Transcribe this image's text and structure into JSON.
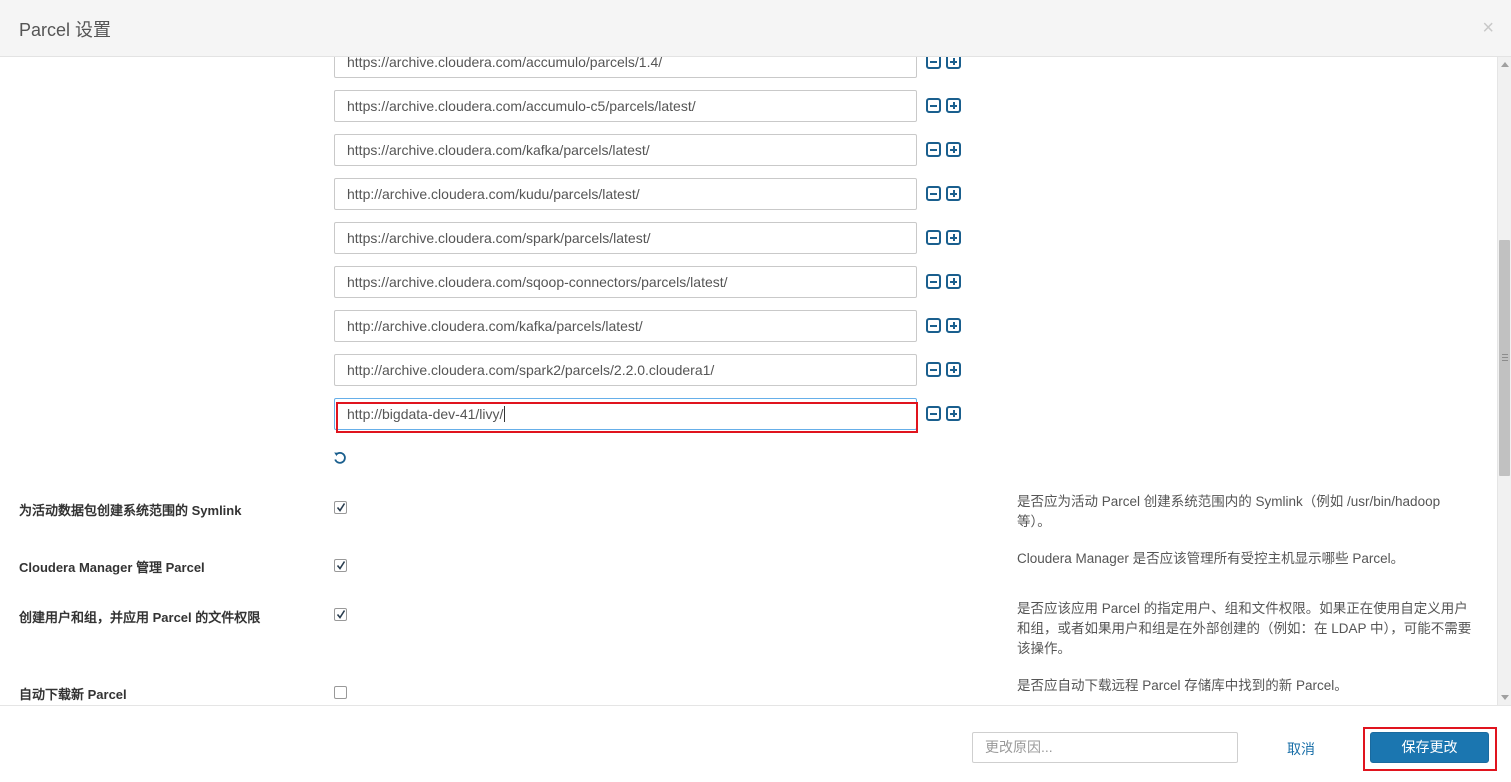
{
  "dialog": {
    "title": "Parcel 设置",
    "close_glyph": "×"
  },
  "repository_urls": [
    "https://archive.cloudera.com/accumulo/parcels/1.4/",
    "https://archive.cloudera.com/accumulo-c5/parcels/latest/",
    "https://archive.cloudera.com/kafka/parcels/latest/",
    "http://archive.cloudera.com/kudu/parcels/latest/",
    "https://archive.cloudera.com/spark/parcels/latest/",
    "https://archive.cloudera.com/sqoop-connectors/parcels/latest/",
    "http://archive.cloudera.com/kafka/parcels/latest/",
    "http://archive.cloudera.com/spark2/parcels/2.2.0.cloudera1/",
    "http://bigdata-dev-41/livy/"
  ],
  "settings": [
    {
      "label": "为活动数据包创建系统范围的 Symlink",
      "checked": true,
      "description": "是否应为活动 Parcel 创建系统范围内的 Symlink（例如 /usr/bin/hadoop 等）。"
    },
    {
      "label": "Cloudera Manager 管理 Parcel",
      "checked": true,
      "description": "Cloudera Manager 是否应该管理所有受控主机显示哪些 Parcel。"
    },
    {
      "label": "创建用户和组，并应用 Parcel 的文件权限",
      "checked": true,
      "description": "是否应该应用 Parcel 的指定用户、组和文件权限。如果正在使用自定义用户和组，或者如果用户和组是在外部创建的（例如：在 LDAP 中），可能不需要该操作。"
    },
    {
      "label": "自动下载新 Parcel",
      "checked": false,
      "description": "是否应自动下载远程 Parcel 存储库中找到的新 Parcel。"
    }
  ],
  "footer": {
    "reason_placeholder": "更改原因...",
    "cancel_label": "取消",
    "save_label": "保存更改"
  },
  "icons": {
    "remove": "minus-square-icon",
    "add": "plus-square-icon",
    "undo": "undo-icon",
    "close": "close-icon"
  },
  "colors": {
    "accent": "#1b76b0",
    "highlight": "#e0141e"
  }
}
